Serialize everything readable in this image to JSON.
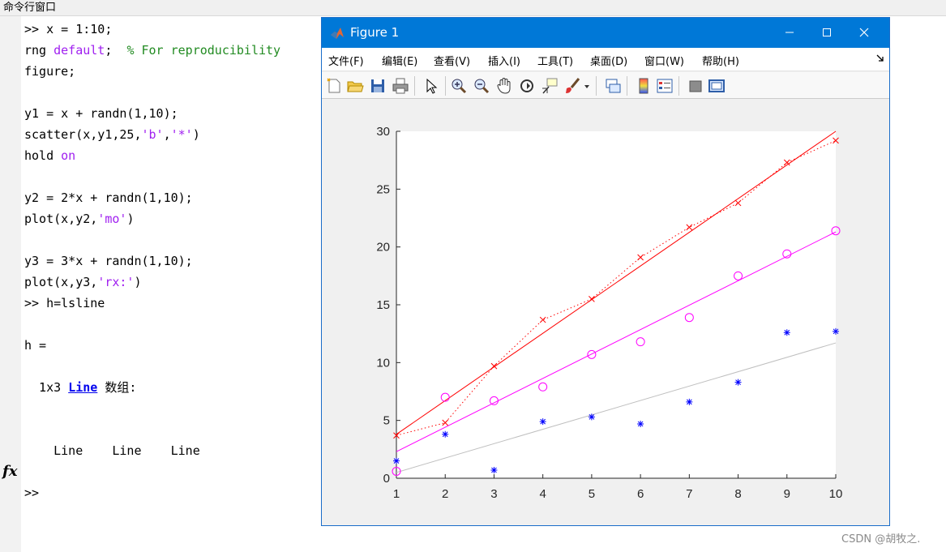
{
  "command_window": {
    "title": "命令行窗口",
    "lines": [
      [
        {
          "t": ">> x = 1:10;",
          "c": ""
        }
      ],
      [
        {
          "t": "rng ",
          "c": ""
        },
        {
          "t": "default",
          "c": "kw"
        },
        {
          "t": ";  ",
          "c": ""
        },
        {
          "t": "% For reproducibility",
          "c": "cm"
        }
      ],
      [
        {
          "t": "figure;",
          "c": ""
        }
      ],
      [],
      [
        {
          "t": "y1 = x + randn(1,10);",
          "c": ""
        }
      ],
      [
        {
          "t": "scatter(x,y1,25,",
          "c": ""
        },
        {
          "t": "'b'",
          "c": "str"
        },
        {
          "t": ",",
          "c": ""
        },
        {
          "t": "'*'",
          "c": "str"
        },
        {
          "t": ")",
          "c": ""
        }
      ],
      [
        {
          "t": "hold ",
          "c": ""
        },
        {
          "t": "on",
          "c": "kw"
        }
      ],
      [],
      [
        {
          "t": "y2 = 2*x + randn(1,10);",
          "c": ""
        }
      ],
      [
        {
          "t": "plot(x,y2,",
          "c": ""
        },
        {
          "t": "'mo'",
          "c": "str"
        },
        {
          "t": ")",
          "c": ""
        }
      ],
      [],
      [
        {
          "t": "y3 = 3*x + randn(1,10);",
          "c": ""
        }
      ],
      [
        {
          "t": "plot(x,y3,",
          "c": ""
        },
        {
          "t": "'rx:'",
          "c": "str"
        },
        {
          "t": ")",
          "c": ""
        }
      ],
      [
        {
          "t": ">> h=lsline",
          "c": ""
        }
      ],
      [],
      [
        {
          "t": "h =",
          "c": ""
        }
      ],
      [],
      [
        {
          "t": "  1x3 ",
          "c": ""
        },
        {
          "t": "Line",
          "c": "lnk"
        },
        {
          "t": " 数组:",
          "c": ""
        }
      ],
      [],
      [],
      [
        {
          "t": "    Line    Line    Line",
          "c": ""
        }
      ],
      [],
      [
        {
          "t": ">>",
          "c": ""
        }
      ]
    ],
    "fx_label": "fx"
  },
  "figure_window": {
    "title": "Figure 1",
    "menu": [
      "文件(F)",
      "编辑(E)",
      "查看(V)",
      "插入(I)",
      "工具(T)",
      "桌面(D)",
      "窗口(W)",
      "帮助(H)"
    ],
    "toolbar_icons": [
      "new-figure-icon",
      "open-file-icon",
      "save-icon",
      "print-icon",
      "select-arrow-icon",
      "zoom-in-icon",
      "zoom-out-icon",
      "pan-hand-icon",
      "rotate-3d-icon",
      "data-cursor-icon",
      "brush-icon",
      "link-plot-icon",
      "colorbar-icon",
      "legend-icon",
      "hide-plot-tools-icon",
      "show-plot-tools-icon"
    ],
    "colors": {
      "titlebar": "#0078d7",
      "series1": "#0000ff",
      "series2": "#ff00ff",
      "series3": "#ff0000",
      "fit1": "#bfbfbf"
    }
  },
  "chart_data": {
    "type": "scatter",
    "x": [
      1,
      2,
      3,
      4,
      5,
      6,
      7,
      8,
      9,
      10
    ],
    "xlim": [
      1,
      10
    ],
    "ylim": [
      0,
      30
    ],
    "xticks": [
      1,
      2,
      3,
      4,
      5,
      6,
      7,
      8,
      9,
      10
    ],
    "yticks": [
      0,
      5,
      10,
      15,
      20,
      25,
      30
    ],
    "grid": false,
    "series": [
      {
        "marker": "*",
        "color": "#0000ff",
        "line": "none",
        "values": [
          1.5,
          3.8,
          0.7,
          4.9,
          5.3,
          4.7,
          6.6,
          8.3,
          12.6,
          12.7
        ]
      },
      {
        "marker": "o",
        "color": "#ff00ff",
        "line": "none",
        "values": [
          0.6,
          7.0,
          6.7,
          7.9,
          10.7,
          11.8,
          13.9,
          17.5,
          19.4,
          21.4
        ]
      },
      {
        "marker": "x",
        "color": "#ff0000",
        "line": "dotted",
        "values": [
          3.7,
          4.8,
          9.7,
          13.7,
          15.5,
          19.1,
          21.7,
          23.8,
          27.3,
          29.2
        ]
      }
    ],
    "fit_lines": [
      {
        "color": "#bfbfbf",
        "y_at_xmin": 0.5,
        "y_at_xmax": 11.7
      },
      {
        "color": "#ff00ff",
        "y_at_xmin": 2.3,
        "y_at_xmax": 21.3
      },
      {
        "color": "#ff0000",
        "y_at_xmin": 3.8,
        "y_at_xmax": 30.0
      }
    ]
  },
  "watermark": "CSDN @胡牧之."
}
